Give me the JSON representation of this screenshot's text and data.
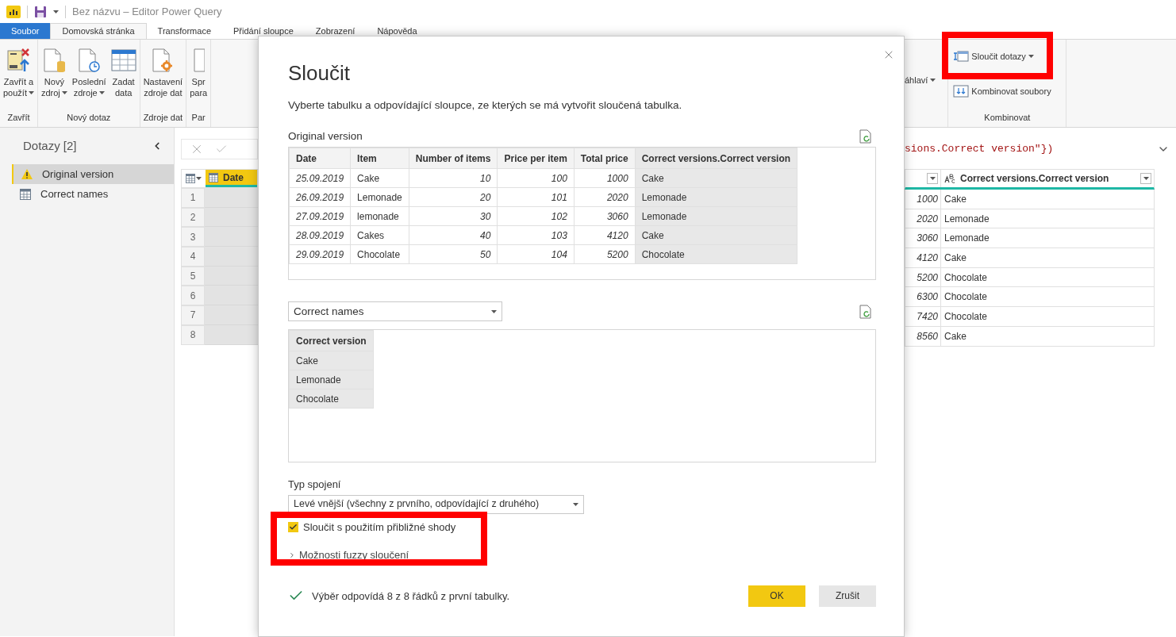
{
  "title_bar": {
    "title": "Bez názvu – Editor Power Query"
  },
  "menu_tabs": [
    {
      "label": "Soubor",
      "kind": "file",
      "selected": false
    },
    {
      "label": "Domovská stránka",
      "kind": "tab",
      "selected": true
    },
    {
      "label": "Transformace",
      "kind": "tab",
      "selected": false
    },
    {
      "label": "Přidání sloupce",
      "kind": "tab",
      "selected": false
    },
    {
      "label": "Zobrazení",
      "kind": "tab",
      "selected": false
    },
    {
      "label": "Nápověda",
      "kind": "tab",
      "selected": false
    }
  ],
  "ribbon_left": {
    "groups": [
      {
        "label": "Zavřít",
        "buttons": [
          {
            "lines": [
              "Zavřít a",
              "použít"
            ],
            "dropdown": true
          }
        ]
      },
      {
        "label": "Nový dotaz",
        "buttons": [
          {
            "lines": [
              "Nový",
              "zdroj"
            ],
            "dropdown": true
          },
          {
            "lines": [
              "Poslední",
              "zdroje"
            ],
            "dropdown": true
          },
          {
            "lines": [
              "Zadat",
              "data"
            ],
            "dropdown": false
          }
        ]
      },
      {
        "label": "Zdroje dat",
        "buttons": [
          {
            "lines": [
              "Nastavení",
              "zdroje dat"
            ],
            "dropdown": false
          }
        ]
      },
      {
        "label": "Par",
        "buttons": [
          {
            "lines": [
              "Spr",
              "para"
            ],
            "dropdown": false
          }
        ]
      }
    ]
  },
  "ribbon_right": {
    "partial_button": {
      "label": "áhlaví",
      "dropdown": true
    },
    "group": {
      "label": "Kombinovat",
      "items": [
        {
          "label": "Sloučit dotazy",
          "dropdown": true
        },
        {
          "label": "Kombinovat soubory",
          "dropdown": false
        }
      ]
    }
  },
  "queries_panel": {
    "title": "Dotazy [2]",
    "items": [
      {
        "name": "Original version",
        "warning": true,
        "selected": true
      },
      {
        "name": "Correct names",
        "warning": false,
        "selected": false
      }
    ]
  },
  "formula_bar": {
    "formula": "sions.Correct version\"})"
  },
  "grid_left": {
    "header": "Date",
    "row_numbers": [
      "1",
      "2",
      "3",
      "4",
      "5",
      "6",
      "7",
      "8"
    ]
  },
  "grid_right": {
    "column_2_header": "Correct versions.Correct version",
    "rows": [
      [
        "1000",
        "Cake"
      ],
      [
        "2020",
        "Lemonade"
      ],
      [
        "3060",
        "Lemonade"
      ],
      [
        "4120",
        "Cake"
      ],
      [
        "5200",
        "Chocolate"
      ],
      [
        "6300",
        "Chocolate"
      ],
      [
        "7420",
        "Chocolate"
      ],
      [
        "8560",
        "Cake"
      ]
    ]
  },
  "dialog": {
    "title": "Sloučit",
    "description": "Vyberte tabulku a odpovídající sloupce, ze kterých se má vytvořit sloučená tabulka.",
    "first_table": {
      "label": "Original version",
      "columns": [
        {
          "label": "Date",
          "kind": "date",
          "highlighted": false
        },
        {
          "label": "Item",
          "kind": "text",
          "highlighted": false
        },
        {
          "label": "Number of items",
          "kind": "number",
          "highlighted": false
        },
        {
          "label": "Price per item",
          "kind": "number",
          "highlighted": false
        },
        {
          "label": "Total price",
          "kind": "number",
          "highlighted": false
        },
        {
          "label": "Correct versions.Correct version",
          "kind": "text",
          "highlighted": true
        }
      ],
      "rows": [
        [
          "25.09.2019",
          "Cake",
          "10",
          "100",
          "1000",
          "Cake"
        ],
        [
          "26.09.2019",
          "Lemonade",
          "20",
          "101",
          "2020",
          "Lemonade"
        ],
        [
          "27.09.2019",
          "lemonade",
          "30",
          "102",
          "3060",
          "Lemonade"
        ],
        [
          "28.09.2019",
          "Cakes",
          "40",
          "103",
          "4120",
          "Cake"
        ],
        [
          "29.09.2019",
          "Chocolate",
          "50",
          "104",
          "5200",
          "Chocolate"
        ]
      ]
    },
    "second_table": {
      "dropdown": "Correct names",
      "columns": [
        {
          "label": "Correct version",
          "highlighted": true
        }
      ],
      "rows": [
        [
          "Cake"
        ],
        [
          "Lemonade"
        ],
        [
          "Chocolate"
        ]
      ]
    },
    "join_type": {
      "label": "Typ spojení",
      "value": "Levé vnější (všechny z prvního, odpovídající z druhého)"
    },
    "fuzzy_checkbox": {
      "label": "Sloučit s použitím přibližné shody",
      "checked": true
    },
    "fuzzy_options": {
      "label": "Možnosti fuzzy sloučení",
      "expanded": false
    },
    "status": {
      "message": "Výběr odpovídá 8 z 8 řádků z první tabulky."
    },
    "buttons": [
      {
        "label": "OK",
        "kind": "primary"
      },
      {
        "label": "Zrušit",
        "kind": "secondary"
      }
    ]
  }
}
